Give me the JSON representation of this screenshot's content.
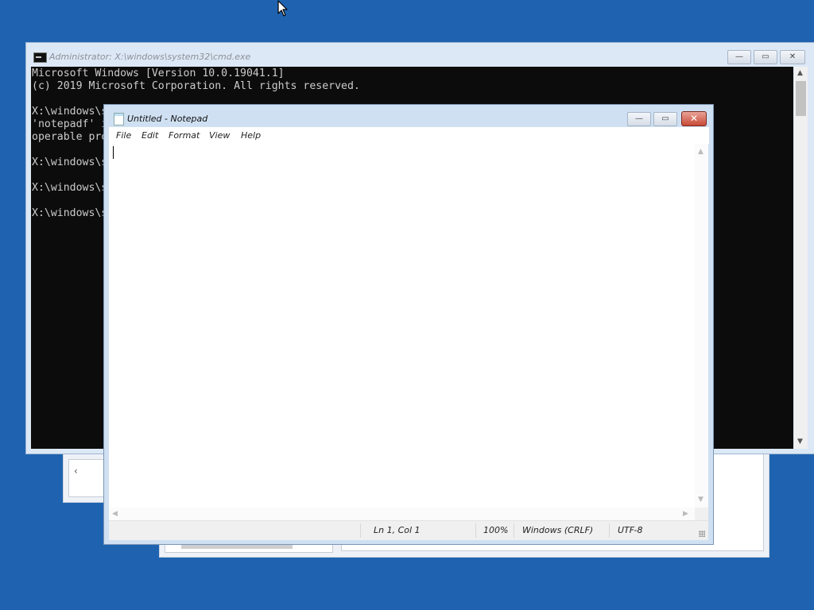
{
  "cmd": {
    "title": "Administrator: X:\\windows\\system32\\cmd.exe",
    "lines": [
      "Microsoft Windows [Version 10.0.19041.1]",
      "(c) 2019 Microsoft Corporation. All rights reserved.",
      "",
      "X:\\windows\\s",
      "'notepadf' i",
      "operable pro",
      "",
      "X:\\windows\\s",
      "",
      "X:\\windows\\s",
      "",
      "X:\\windows\\s"
    ],
    "buttons": {
      "minimize": "—",
      "maximize": "▭",
      "close": "✕"
    }
  },
  "notepad": {
    "title": "Untitled - Notepad",
    "menu": [
      "File",
      "Edit",
      "Format",
      "View",
      "Help"
    ],
    "content": "",
    "status": {
      "position": "Ln 1, Col 1",
      "zoom": "100%",
      "line_ending": "Windows (CRLF)",
      "encoding": "UTF-8"
    },
    "buttons": {
      "minimize": "—",
      "maximize": "▭",
      "close": "✕"
    }
  },
  "arrows": {
    "up": "▲",
    "down": "▼",
    "left": "◀",
    "right": "▶",
    "bg_left": "‹"
  }
}
